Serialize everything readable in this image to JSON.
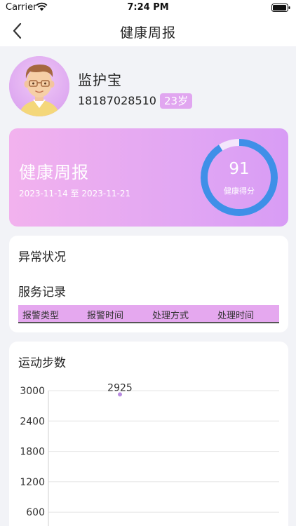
{
  "status_bar": {
    "carrier": "Carrier",
    "time": "7:24 PM"
  },
  "nav": {
    "title": "健康周报",
    "back_icon": "chevron-left-icon"
  },
  "profile": {
    "name": "监护宝",
    "phone": "18187028510",
    "age": "23岁"
  },
  "report": {
    "title": "健康周报",
    "date_range": "2023-11-14 至 2023-11-21",
    "score": "91",
    "score_label": "健康得分",
    "score_fraction": 0.91
  },
  "abnormal": {
    "title": "异常状况",
    "service_title": "服务记录",
    "columns": [
      "报警类型",
      "报警时间",
      "处理方式",
      "处理时间"
    ]
  },
  "steps": {
    "title": "运动步数"
  },
  "colors": {
    "accent": "#e1a6f0",
    "ring": "#3f8fe8",
    "point": "#b98be0"
  },
  "chart_data": {
    "type": "scatter",
    "y_ticks": [
      "3000",
      "2400",
      "1800",
      "1200",
      "600"
    ],
    "ylim": [
      0,
      3000
    ],
    "points": [
      {
        "y": 2925,
        "label": "2925"
      }
    ]
  }
}
